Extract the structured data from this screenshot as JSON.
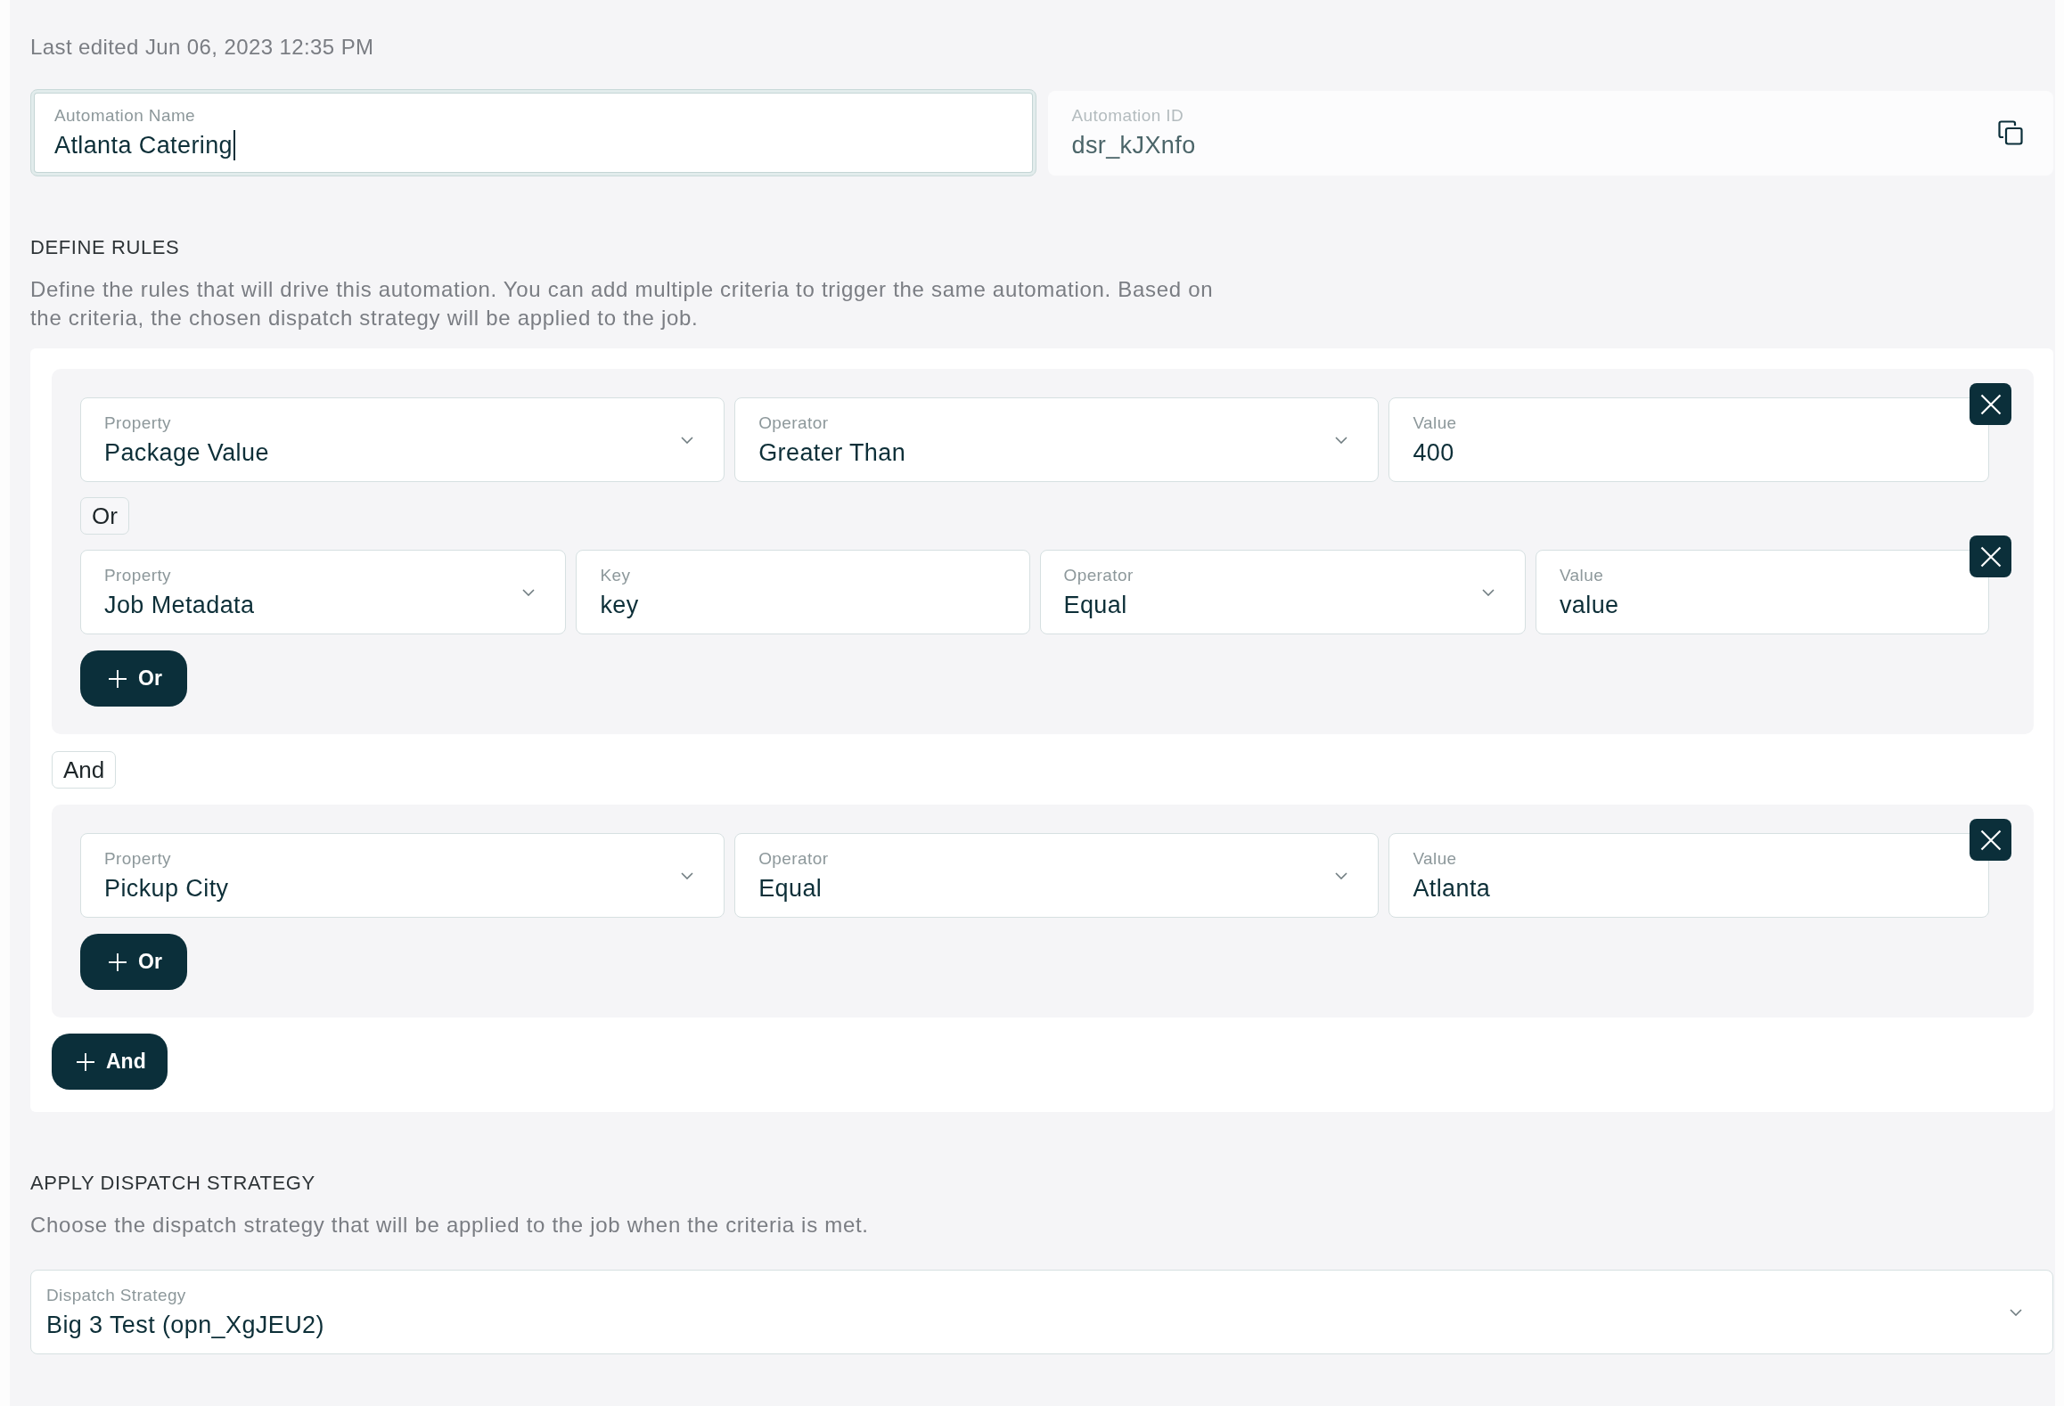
{
  "header": {
    "last_edited": "Last edited Jun 06, 2023 12:35 PM"
  },
  "automation_name": {
    "label": "Automation Name",
    "value": "Atlanta Catering",
    "focused": true
  },
  "automation_id": {
    "label": "Automation ID",
    "value": "dsr_kJXnfo",
    "read_only": true
  },
  "define_rules": {
    "heading": "DEFINE RULES",
    "description": "Define the rules that will drive this automation. You can add multiple criteria to trigger the same automation. Based on the criteria, the chosen dispatch strategy will be applied to the job.",
    "groups": [
      {
        "criteria": [
          {
            "fields": [
              {
                "kind": "select",
                "label": "Property",
                "value": "Package Value"
              },
              {
                "kind": "select",
                "label": "Operator",
                "value": "Greater Than"
              },
              {
                "kind": "text",
                "label": "Value",
                "value": "400"
              }
            ]
          },
          {
            "connector": "Or",
            "fields": [
              {
                "kind": "select",
                "label": "Property",
                "value": "Job Metadata"
              },
              {
                "kind": "text",
                "label": "Key",
                "value": "key"
              },
              {
                "kind": "select",
                "label": "Operator",
                "value": "Equal"
              },
              {
                "kind": "text",
                "label": "Value",
                "value": "value"
              }
            ]
          }
        ],
        "add_button": "Or"
      },
      {
        "connector": "And",
        "criteria": [
          {
            "fields": [
              {
                "kind": "select",
                "label": "Property",
                "value": "Pickup City"
              },
              {
                "kind": "select",
                "label": "Operator",
                "value": "Equal"
              },
              {
                "kind": "text",
                "label": "Value",
                "value": "Atlanta"
              }
            ]
          }
        ],
        "add_button": "Or"
      }
    ],
    "add_button": "And"
  },
  "dispatch_strategy": {
    "heading": "APPLY DISPATCH STRATEGY",
    "description": "Choose the dispatch strategy that will be applied to the job when the criteria is met.",
    "field": {
      "label": "Dispatch Strategy",
      "value": "Big 3 Test (opn_XgJEU2)"
    }
  }
}
